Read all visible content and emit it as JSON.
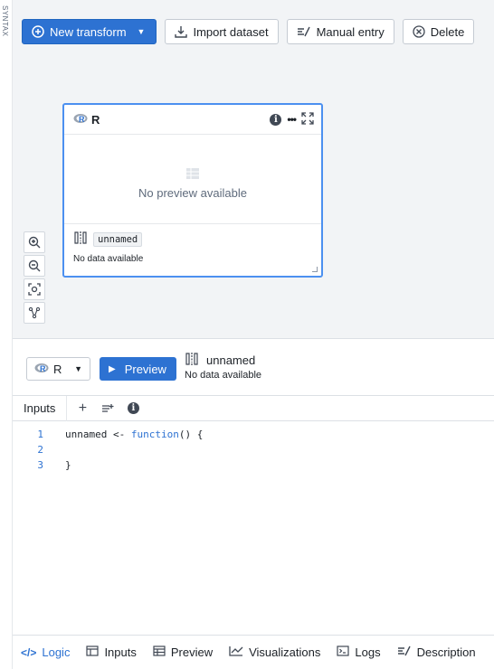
{
  "side_label": "SYNTAX",
  "toolbar": {
    "new_transform": "New transform",
    "import_dataset": "Import dataset",
    "manual_entry": "Manual entry",
    "delete": "Delete"
  },
  "node": {
    "title": "R",
    "empty_text": "No preview available",
    "dataset_tag": "unnamed",
    "footer_note": "No data available"
  },
  "editor": {
    "language": "R",
    "preview_label": "Preview",
    "output_name": "unnamed",
    "output_note": "No data available"
  },
  "inputs_bar": {
    "label": "Inputs"
  },
  "code": {
    "lines": [
      {
        "n": "1",
        "before": "unnamed <- ",
        "kw": "function",
        "after": "() {"
      },
      {
        "n": "2",
        "before": "",
        "kw": "",
        "after": ""
      },
      {
        "n": "3",
        "before": "}",
        "kw": "",
        "after": ""
      }
    ]
  },
  "tabs": {
    "logic": "Logic",
    "inputs": "Inputs",
    "preview": "Preview",
    "visualizations": "Visualizations",
    "logs": "Logs",
    "description": "Description"
  },
  "colors": {
    "accent": "#2d72d2"
  }
}
